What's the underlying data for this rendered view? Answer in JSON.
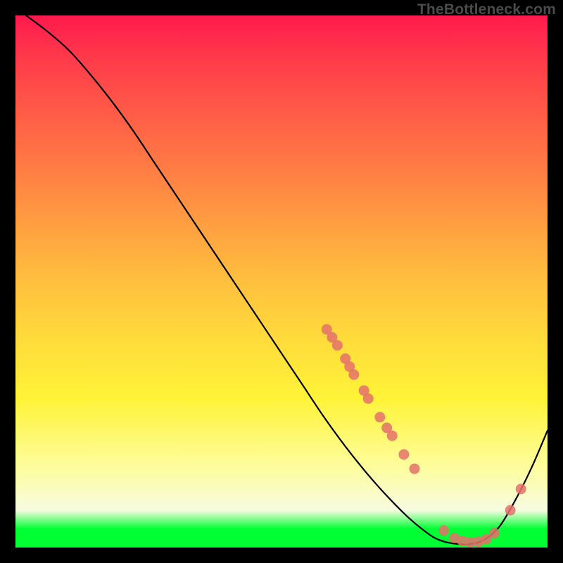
{
  "watermark": "TheBottleneck.com",
  "chart_data": {
    "type": "line",
    "title": "",
    "xlabel": "",
    "ylabel": "",
    "xlim": [
      0,
      100
    ],
    "ylim": [
      0,
      100
    ],
    "grid": false,
    "legend": false,
    "series": [
      {
        "name": "bottleneck-curve",
        "x": [
          2,
          6,
          10,
          14,
          18,
          22,
          26,
          30,
          34,
          38,
          42,
          46,
          50,
          54,
          58,
          62,
          66,
          70,
          74,
          78,
          80,
          82,
          85,
          88,
          91,
          94,
          97,
          100
        ],
        "y": [
          100,
          97,
          93.5,
          89,
          84,
          78.5,
          72.5,
          66.5,
          60.5,
          54.5,
          48.5,
          42.5,
          36.5,
          30.5,
          24.5,
          19,
          14,
          9.5,
          5.5,
          2.3,
          1.3,
          0.8,
          0.6,
          1.4,
          4,
          9,
          15,
          22
        ],
        "color": "#000000"
      }
    ],
    "scatter_points": {
      "name": "highlighted-points",
      "color": "#e4716b",
      "points": [
        {
          "x": 58.5,
          "y": 41
        },
        {
          "x": 59.5,
          "y": 39.5
        },
        {
          "x": 60.5,
          "y": 38
        },
        {
          "x": 62,
          "y": 35.5
        },
        {
          "x": 62.8,
          "y": 34
        },
        {
          "x": 63.6,
          "y": 32.5
        },
        {
          "x": 65.5,
          "y": 29.5
        },
        {
          "x": 66.3,
          "y": 28
        },
        {
          "x": 68.5,
          "y": 24.5
        },
        {
          "x": 69.8,
          "y": 22.5
        },
        {
          "x": 70.8,
          "y": 21
        },
        {
          "x": 73,
          "y": 17.5
        },
        {
          "x": 75,
          "y": 14.8
        },
        {
          "x": 80.5,
          "y": 3.2
        },
        {
          "x": 82.5,
          "y": 1.8
        },
        {
          "x": 84,
          "y": 1.2
        },
        {
          "x": 85.5,
          "y": 1.0
        },
        {
          "x": 87,
          "y": 1.1
        },
        {
          "x": 88.5,
          "y": 1.6
        },
        {
          "x": 90,
          "y": 2.7
        },
        {
          "x": 93,
          "y": 7.0
        },
        {
          "x": 95,
          "y": 11.0
        }
      ]
    }
  }
}
